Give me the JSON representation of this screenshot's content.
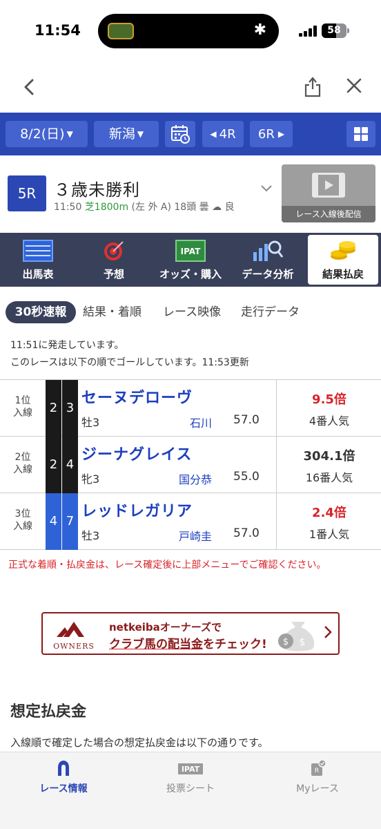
{
  "status": {
    "time": "11:54",
    "battery": "58"
  },
  "race_bar": {
    "date": "8/2(日)",
    "venue": "新潟",
    "prev_race": "4R",
    "next_race": "6R"
  },
  "race": {
    "number": "5R",
    "title": "３歳未勝利",
    "time": "11:50",
    "course": "芝1800m",
    "details": "(左 外 A) 18頭 曇",
    "going": "良",
    "video_label": "レース入線後配信"
  },
  "categories": [
    "出馬表",
    "予想",
    "オッズ・購入",
    "データ分析",
    "結果払戻"
  ],
  "sub_tabs": [
    "30秒速報",
    "結果・着順",
    "レース映像",
    "走行データ"
  ],
  "messages": {
    "start": "11:51に発走しています。",
    "goal": "このレースは以下の順でゴールしています。11:53更新"
  },
  "results": [
    {
      "rank": "1位",
      "status": "入線",
      "frame": "2",
      "number": "3",
      "horse": "セーヌデローヴ",
      "sex_age": "牡3",
      "jockey": "石川",
      "weight": "57.0",
      "odds": "9.5倍",
      "popularity": "4番人気"
    },
    {
      "rank": "2位",
      "status": "入線",
      "frame": "2",
      "number": "4",
      "horse": "ジーナグレイス",
      "sex_age": "牝3",
      "jockey": "国分恭",
      "weight": "55.0",
      "odds": "304.1倍",
      "popularity": "16番人気"
    },
    {
      "rank": "3位",
      "status": "入線",
      "frame": "4",
      "number": "7",
      "horse": "レッドレガリア",
      "sex_age": "牡3",
      "jockey": "戸崎圭",
      "weight": "57.0",
      "odds": "2.4倍",
      "popularity": "1番人気"
    }
  ],
  "notice": "正式な着順・払戻金は、レース確定後に上部メニューでご確認ください。",
  "banner": {
    "logo": "OWNERS",
    "line1": "netkeibaオーナーズで",
    "line2_em": "クラブ馬の配当金",
    "line2_rest": "をチェック!"
  },
  "estimate": {
    "title": "想定払戻金",
    "text": "入線順で確定した場合の想定払戻金は以下の通りです。"
  },
  "tabbar": {
    "tabs": [
      "レース情報",
      "投票シート",
      "Myレース"
    ],
    "ipat_label": "IPAT",
    "myrace_badge": "R"
  },
  "colors": {
    "brand_blue": "#2b47b3",
    "menu_dark": "#39405a",
    "odds_red": "#d8232a",
    "frame_black": "#1a1a1a",
    "frame_blue": "#2e63d8"
  }
}
